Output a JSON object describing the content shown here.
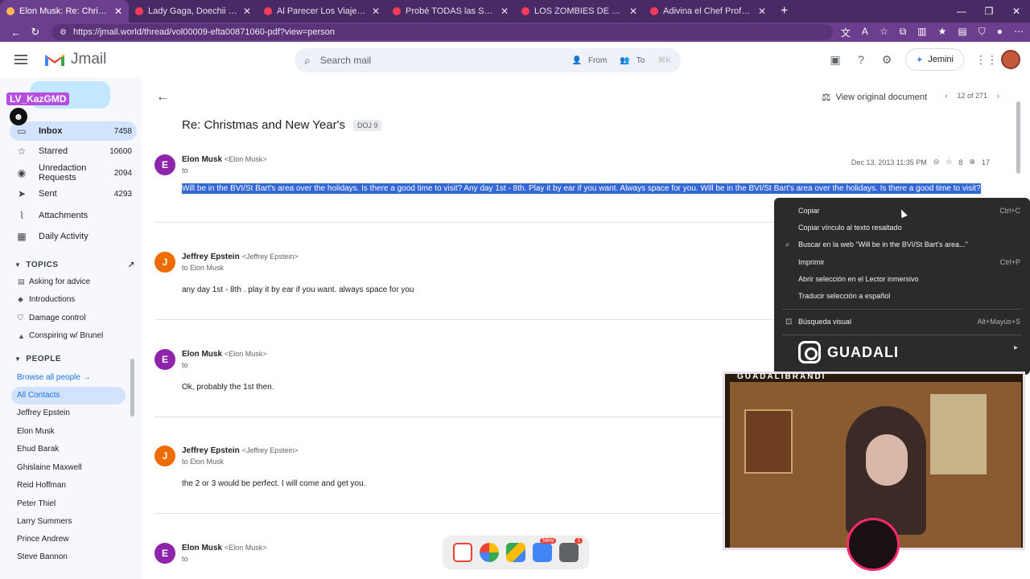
{
  "browser": {
    "tabs": [
      {
        "title": "Elon Musk: Re: Christmas and New"
      },
      {
        "title": "Lady Gaga, Doechii - RUNWAY (Of"
      },
      {
        "title": "Al Parecer Los Viajes En El Tiempo"
      },
      {
        "title": "Probé TODAS las Salas de Cine en"
      },
      {
        "title": "LOS ZOMBIES DE FRANKFURT (JA"
      },
      {
        "title": "Adivina el Chef Profesional - YouT"
      }
    ],
    "url": "https://jmail.world/thread/vol00009-efta00871060-pdf?view=person"
  },
  "header": {
    "brand": "Jmail",
    "search_placeholder": "Search mail",
    "filter_from": "From",
    "filter_to": "To",
    "shortcut": "⌘K",
    "jemini_label": "Jemini"
  },
  "sidebar": {
    "nav": [
      {
        "label": "Inbox",
        "count": "7458",
        "icon": "inbox-icon"
      },
      {
        "label": "Starred",
        "count": "10600",
        "icon": "star-icon"
      },
      {
        "label": "Unredaction Requests",
        "count": "2094",
        "icon": "unredact-icon"
      },
      {
        "label": "Sent",
        "count": "4293",
        "icon": "send-icon"
      },
      {
        "label": "Attachments",
        "count": "",
        "icon": "paperclip-icon"
      },
      {
        "label": "Daily Activity",
        "count": "",
        "icon": "calendar-icon"
      }
    ],
    "topics_heading": "TOPICS",
    "topics": [
      "Asking for advice",
      "Introductions",
      "Damage control",
      "Conspiring w/ Brunel"
    ],
    "people_heading": "PEOPLE",
    "browse_people": "Browse all people →",
    "all_contacts": "All Contacts",
    "people": [
      "Jeffrey Epstein",
      "Elon Musk",
      "Ehud Barak",
      "Ghislaine Maxwell",
      "Reid Hoffman",
      "Peter Thiel",
      "Larry Summers",
      "Prince Andrew",
      "Steve Bannon"
    ]
  },
  "thread": {
    "view_original": "View original document",
    "pager": "12 of 271",
    "subject": "Re: Christmas and New Year's",
    "tag": "DOJ 9",
    "messages": [
      {
        "sender": "Elon Musk",
        "addr": "<Elon Musk>",
        "to": "to",
        "date": "Dec 13, 2013 11:35 PM",
        "views": "8",
        "zoom": "17",
        "body": "Will be in the BVI/St Bart's area over the holidays. Is there a good time to visit? Any day 1st - 8th. Play it by ear if you want. Always space for you. Will be in the BVI/St Bart's area over the holidays. Is there a good time to visit?"
      },
      {
        "sender": "Jeffrey Epstein",
        "addr": "<Jeffrey Epstein>",
        "to": "to Elon Musk",
        "body": "any day 1st - 8th . play it by ear if you want. always space for you"
      },
      {
        "sender": "Elon Musk",
        "addr": "<Elon Musk>",
        "to": "to",
        "body": "Ok, probably the 1st then."
      },
      {
        "sender": "Jeffrey Epstein",
        "addr": "<Jeffrey Epstein>",
        "to": "to Elon Musk",
        "body": "the 2 or 3 would be perfect. I will come and get you."
      },
      {
        "sender": "Elon Musk",
        "addr": "<Elon Musk>",
        "to": "to",
        "body": ""
      }
    ]
  },
  "context_menu": {
    "items": [
      {
        "label": "Copiar",
        "shortcut": "Ctrl+C"
      },
      {
        "label": "Copiar vínculo al texto resaltado",
        "shortcut": ""
      },
      {
        "label": "Buscar en la web \"Will be in the BVI/St Bart's area...\"",
        "shortcut": ""
      },
      {
        "label": "Imprimir",
        "shortcut": "Ctrl+P"
      },
      {
        "label": "Abrir selección en el Lector inmersivo",
        "shortcut": ""
      },
      {
        "label": "Traducir selección a español",
        "shortcut": ""
      },
      {
        "label": "Búsqueda visual",
        "shortcut": "Alt+Mayús+S"
      }
    ]
  },
  "overlay": {
    "streamer_tag": "LV_KazGMD",
    "insta_name": "GUADALI",
    "cam_name": "GUADALIBRANDI"
  }
}
